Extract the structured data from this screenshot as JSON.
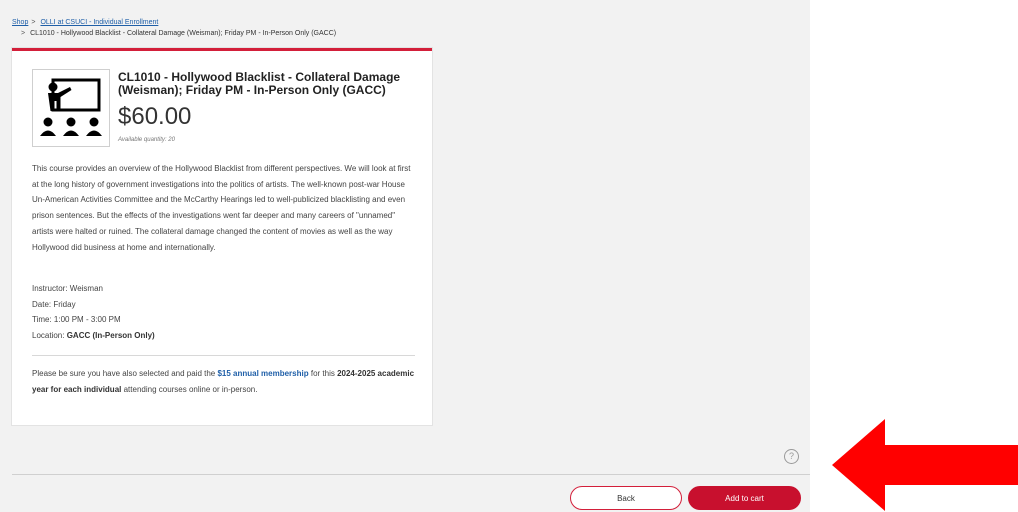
{
  "breadcrumb": {
    "shop": "Shop",
    "category": "OLLI at CSUCI - Individual Enrollment",
    "current": "CL1010 - Hollywood Blacklist - Collateral Damage (Weisman); Friday PM - In-Person Only (GACC)"
  },
  "product": {
    "image_icon": "teacher-presentation-icon",
    "title": "CL1010 - Hollywood Blacklist - Collateral Damage (Weisman); Friday PM - In-Person Only (GACC)",
    "price": "$60.00",
    "availability": "Available quantity: 20",
    "description": "This course provides an overview of the Hollywood Blacklist from different perspectives. We will look at first at the long history of government investigations into the politics of artists. The well-known post-war House Un-American Activities Committee and the McCarthy Hearings led to well-publicized blacklisting and even prison sentences. But the effects of the investigations went far deeper and many careers of \"unnamed\" artists were halted or ruined. The collateral damage changed the content of movies as well as the way Hollywood did business at home and internationally.",
    "instructor": "Instructor: Weisman",
    "date": "Date: Friday",
    "time": "Time: 1:00 PM - 3:00 PM",
    "location_label": "Location: ",
    "location_value": "GACC (In-Person Only)"
  },
  "note": {
    "part1": "Please be sure you have also selected and paid the ",
    "link": "$15 annual membership",
    "part2": " for this ",
    "bold": "2024-2025 academic year for each individual",
    "part3": " attending courses online or in-person."
  },
  "actions": {
    "back": "Back",
    "add_to_cart": "Add to cart"
  },
  "help_icon": "?",
  "colors": {
    "accent": "#c8102e",
    "link": "#1f5fa8",
    "arrow": "#ff0000"
  }
}
